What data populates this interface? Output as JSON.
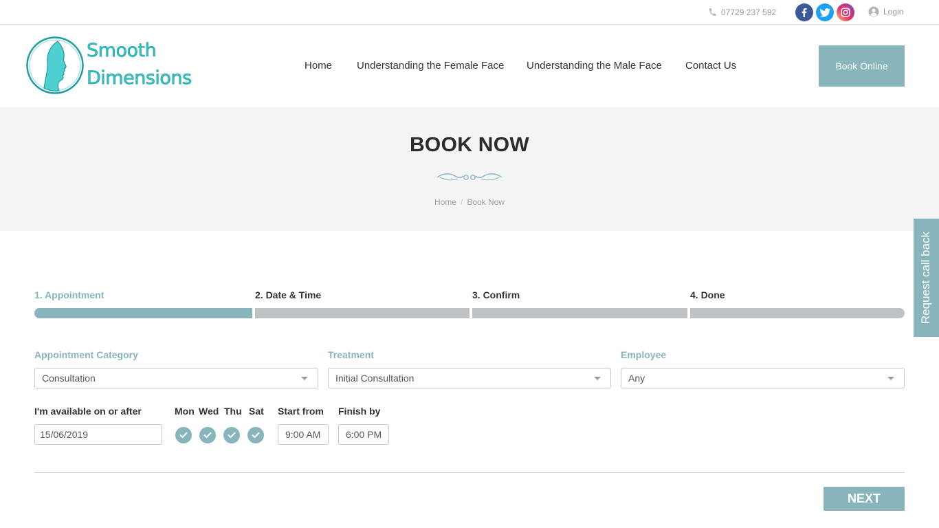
{
  "topbar": {
    "phone": "07729 237 592",
    "login_label": "Login",
    "social": [
      "facebook-icon",
      "twitter-icon",
      "instagram-icon"
    ]
  },
  "logo": {
    "line1": "Smooth",
    "line2": "Dimensions"
  },
  "nav": {
    "items": [
      {
        "label": "Home"
      },
      {
        "label": "Understanding the Female Face"
      },
      {
        "label": "Understanding the Male Face"
      },
      {
        "label": "Contact Us"
      }
    ],
    "cta_label": "Book Online"
  },
  "page_header": {
    "title": "BOOK NOW",
    "breadcrumb": [
      "Home",
      "Book Now"
    ]
  },
  "side_tab": {
    "label": "Request call back"
  },
  "steps": [
    {
      "label": "1. Appointment",
      "active": true
    },
    {
      "label": "2. Date & Time",
      "active": false
    },
    {
      "label": "3. Confirm",
      "active": false
    },
    {
      "label": "4. Done",
      "active": false
    }
  ],
  "form": {
    "category": {
      "label": "Appointment Category",
      "value": "Consultation"
    },
    "treatment": {
      "label": "Treatment",
      "value": "Initial Consultation"
    },
    "employee": {
      "label": "Employee",
      "value": "Any"
    },
    "availability": {
      "label": "I'm available on or after",
      "date": "15/06/2019",
      "days": [
        {
          "label": "Mon",
          "checked": true
        },
        {
          "label": "Wed",
          "checked": true
        },
        {
          "label": "Thu",
          "checked": true
        },
        {
          "label": "Sat",
          "checked": true
        }
      ],
      "start_label": "Start from",
      "start_value": "9:00 AM",
      "finish_label": "Finish by",
      "finish_value": "6:00 PM"
    },
    "next_label": "NEXT"
  },
  "colors": {
    "accent": "#88b4bc",
    "logo": "#36c2c2",
    "band_bg": "#f5f5f5",
    "inactive_step": "#bfc3c6"
  }
}
